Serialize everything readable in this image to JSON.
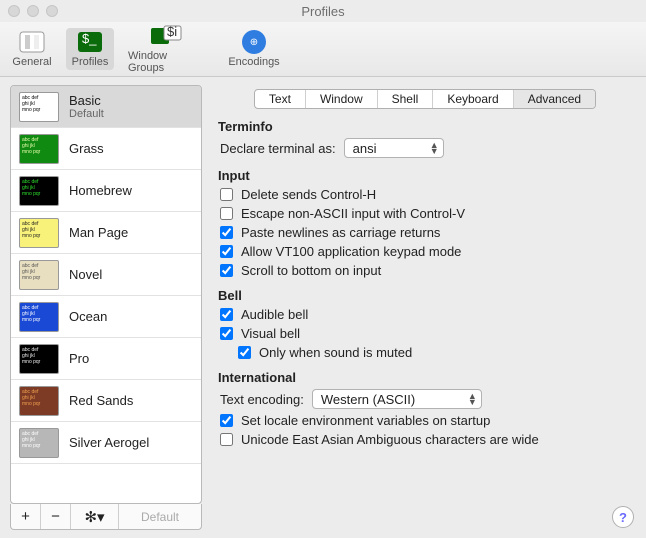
{
  "window": {
    "title": "Profiles"
  },
  "toolbar": {
    "items": [
      {
        "label": "General"
      },
      {
        "label": "Profiles"
      },
      {
        "label": "Window Groups"
      },
      {
        "label": "Encodings"
      }
    ]
  },
  "sidebar": {
    "profiles": [
      {
        "name": "Basic",
        "sub": "Default",
        "bg": "#ffffff",
        "fg": "#000"
      },
      {
        "name": "Grass",
        "sub": "",
        "bg": "#108a10",
        "fg": "#e9ffb0"
      },
      {
        "name": "Homebrew",
        "sub": "",
        "bg": "#000000",
        "fg": "#2ee22e"
      },
      {
        "name": "Man Page",
        "sub": "",
        "bg": "#f9f27a",
        "fg": "#222"
      },
      {
        "name": "Novel",
        "sub": "",
        "bg": "#e8dec0",
        "fg": "#555"
      },
      {
        "name": "Ocean",
        "sub": "",
        "bg": "#1a49d6",
        "fg": "#fff"
      },
      {
        "name": "Pro",
        "sub": "",
        "bg": "#000000",
        "fg": "#eee"
      },
      {
        "name": "Red Sands",
        "sub": "",
        "bg": "#7d3a24",
        "fg": "#f0a050"
      },
      {
        "name": "Silver Aerogel",
        "sub": "",
        "bg": "#b7b7b7",
        "fg": "#fff"
      }
    ],
    "footer": {
      "add": "+",
      "remove": "−",
      "gear": "✻▾",
      "default": "Default"
    }
  },
  "tabs": [
    "Text",
    "Window",
    "Shell",
    "Keyboard",
    "Advanced"
  ],
  "content": {
    "terminfo": {
      "heading": "Terminfo",
      "declare_label": "Declare terminal as:",
      "declare_value": "ansi"
    },
    "input": {
      "heading": "Input",
      "opts": [
        {
          "label": "Delete sends Control-H",
          "checked": false
        },
        {
          "label": "Escape non-ASCII input with Control-V",
          "checked": false
        },
        {
          "label": "Paste newlines as carriage returns",
          "checked": true
        },
        {
          "label": "Allow VT100 application keypad mode",
          "checked": true
        },
        {
          "label": "Scroll to bottom on input",
          "checked": true
        }
      ]
    },
    "bell": {
      "heading": "Bell",
      "audible": {
        "label": "Audible bell",
        "checked": true
      },
      "visual": {
        "label": "Visual bell",
        "checked": true
      },
      "only_muted": {
        "label": "Only when sound is muted",
        "checked": true
      }
    },
    "intl": {
      "heading": "International",
      "encoding_label": "Text encoding:",
      "encoding_value": "Western (ASCII)",
      "locale": {
        "label": "Set locale environment variables on startup",
        "checked": true
      },
      "eastasian": {
        "label": "Unicode East Asian Ambiguous characters are wide",
        "checked": false
      }
    }
  },
  "help": "?"
}
